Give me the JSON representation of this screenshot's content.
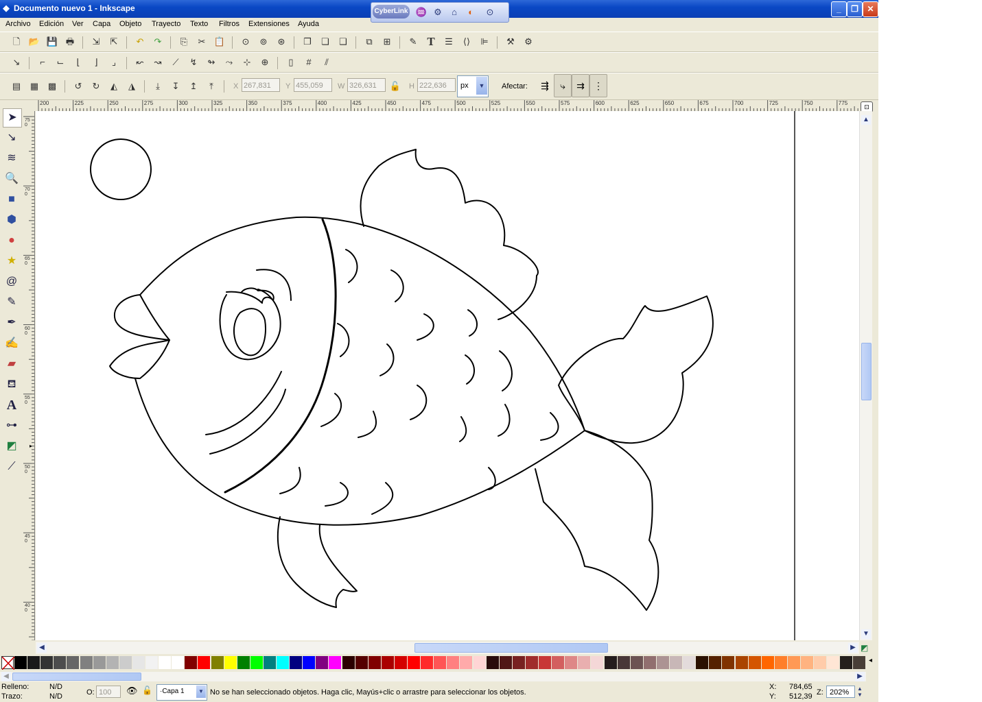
{
  "window": {
    "title": "Documento nuevo 1 - Inkscape"
  },
  "cyberlink": {
    "label": "CyberLink"
  },
  "menu": {
    "items": [
      "Archivo",
      "Edición",
      "Ver",
      "Capa",
      "Objeto",
      "Trayecto",
      "Texto",
      "Filtros",
      "Extensiones",
      "Ayuda"
    ]
  },
  "toolbar_tools": {
    "x_label": "X",
    "x_value": "267,831",
    "y_label": "Y",
    "y_value": "455,059",
    "w_label": "W",
    "w_value": "326,631",
    "h_label": "H",
    "h_value": "222,636",
    "unit": "px",
    "affect_label": "Afectar:"
  },
  "ruler": {
    "h_ticks": [
      "200",
      "225",
      "250",
      "275",
      "300",
      "325",
      "350",
      "375",
      "400",
      "425",
      "450",
      "475",
      "500",
      "525",
      "550",
      "575",
      "600",
      "625",
      "650",
      "675",
      "700",
      "725",
      "750",
      "775"
    ],
    "v_ticks": [
      "750",
      "700",
      "650",
      "600",
      "550",
      "500",
      "450",
      "400"
    ]
  },
  "palette": {
    "colors": [
      "#000000",
      "#1a1a1a",
      "#333333",
      "#4d4d4d",
      "#666666",
      "#808080",
      "#999999",
      "#b3b3b3",
      "#cccccc",
      "#e6e6e6",
      "#f2f2f2",
      "#ffffff",
      "#ffffff",
      "#800000",
      "#ff0000",
      "#808000",
      "#ffff00",
      "#008000",
      "#00ff00",
      "#008080",
      "#00ffff",
      "#000080",
      "#0000ff",
      "#800080",
      "#ff00ff",
      "#2b0000",
      "#550000",
      "#800000",
      "#aa0000",
      "#d40000",
      "#ff0000",
      "#ff2a2a",
      "#ff5555",
      "#ff8080",
      "#ffaaaa",
      "#ffd5d5",
      "#280b0b",
      "#501616",
      "#782121",
      "#a02c2c",
      "#c83737",
      "#d35f5f",
      "#de8787",
      "#e9afaf",
      "#f4d7d7",
      "#241c1c",
      "#483737",
      "#6c5353",
      "#916f6f",
      "#ac9393",
      "#c8b7b7",
      "#e3dbdb",
      "#2b1100",
      "#552200",
      "#803300",
      "#aa4400",
      "#d45500",
      "#ff6600",
      "#ff7f2a",
      "#ff9955",
      "#ffb380",
      "#ffccaa",
      "#ffe6d5",
      "#241f1c",
      "#483e37"
    ]
  },
  "status": {
    "fill_label": "Relleno:",
    "fill_value": "N/D",
    "stroke_label": "Trazo:",
    "stroke_value": "N/D",
    "opacity_label": "O:",
    "opacity_value": "100",
    "layer": "·Capa 1",
    "message": "No se han seleccionado objetos. Haga clic, Mayús+clic o arrastre para seleccionar los objetos.",
    "x_label": "X:",
    "x_value": "784,65",
    "y_label": "Y:",
    "y_value": "512,39",
    "zoom_label": "Z:",
    "zoom_value": "202%"
  }
}
